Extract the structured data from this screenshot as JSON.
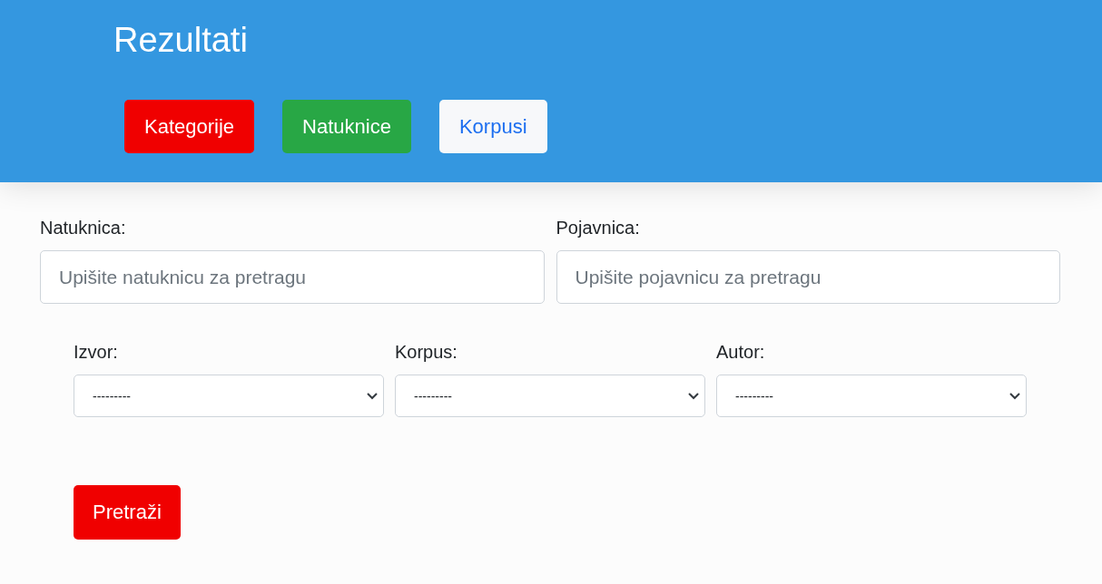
{
  "header": {
    "title": "Rezultati",
    "nav_buttons": [
      {
        "label": "Kategorije",
        "kind": "danger"
      },
      {
        "label": "Natuknice",
        "kind": "success"
      },
      {
        "label": "Korpusi",
        "kind": "light"
      }
    ]
  },
  "search_fields": [
    {
      "label": "Natuknica:",
      "placeholder": "Upišite natuknicu za pretragu"
    },
    {
      "label": "Pojavnica:",
      "placeholder": "Upišite pojavnicu za pretragu"
    }
  ],
  "filters": [
    {
      "label": "Izvor:",
      "value": "---------"
    },
    {
      "label": "Korpus:",
      "value": "---------"
    },
    {
      "label": "Autor:",
      "value": "---------"
    }
  ],
  "submit_button": {
    "label": "Pretraži",
    "kind": "danger"
  }
}
